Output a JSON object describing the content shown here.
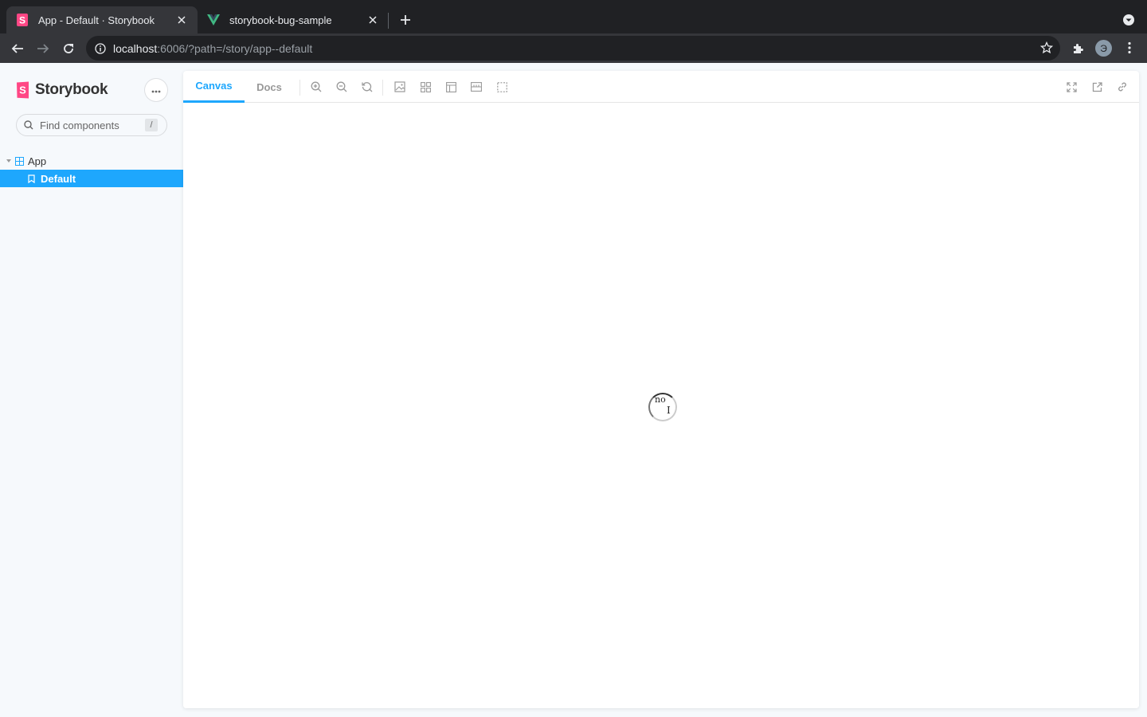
{
  "browser": {
    "tabs": [
      {
        "title": "App - Default · Storybook",
        "active": true,
        "favicon": "storybook-icon"
      },
      {
        "title": "storybook-bug-sample",
        "active": false,
        "favicon": "vue-icon"
      }
    ],
    "address": {
      "host": "localhost",
      "rest": ":6006/?path=/story/app--default"
    },
    "profile_initial": "Э"
  },
  "sidebar": {
    "brand": "Storybook",
    "search": {
      "placeholder": "Find components",
      "shortcut": "/"
    },
    "tree": {
      "component": "App",
      "story": "Default"
    }
  },
  "panel": {
    "tabs": {
      "canvas": "Canvas",
      "docs": "Docs"
    },
    "loader_text_top": "no",
    "loader_text_bottom": "I"
  },
  "colors": {
    "accent": "#1ea7fd",
    "storybook_pink": "#ff4785",
    "vue_green": "#41b883",
    "chrome_dark": "#202124",
    "chrome_toolbar": "#35363a"
  }
}
